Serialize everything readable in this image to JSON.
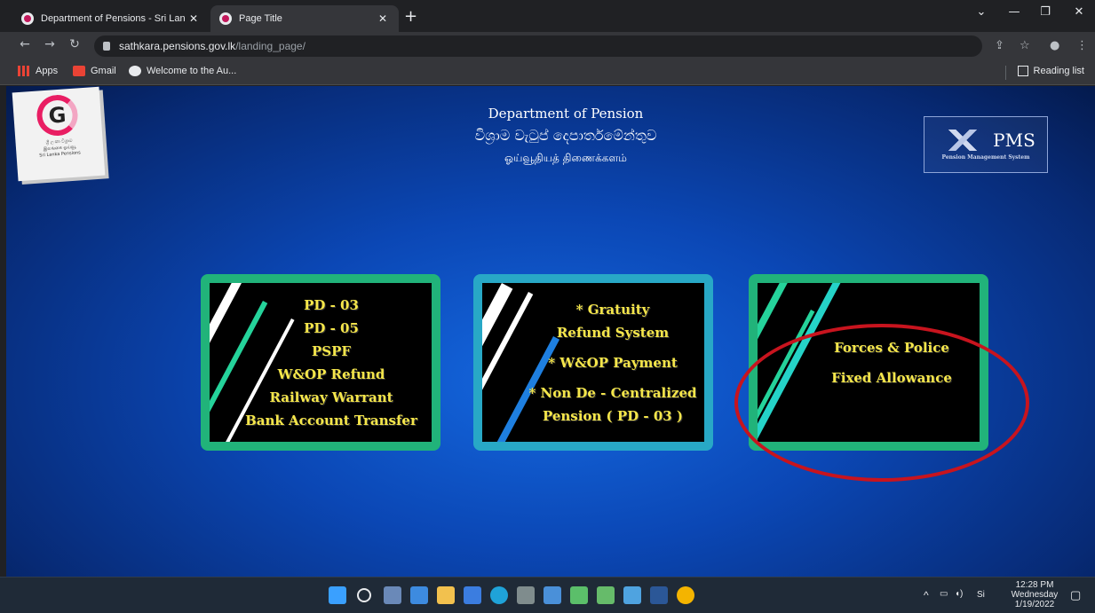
{
  "browser": {
    "tabs": [
      {
        "title": "Department of Pensions - Sri Lan"
      },
      {
        "title": "Page Title"
      }
    ],
    "new_tab": "+",
    "url_host": "sathkara.pensions.gov.lk",
    "url_path": "/landing_page/",
    "bookmarks": [
      {
        "label": "Apps"
      },
      {
        "label": "Gmail"
      },
      {
        "label": "Welcome to the Au..."
      }
    ],
    "reading_list": "Reading list"
  },
  "page": {
    "logo_text": "ශ්‍රී ලංකා විශ්‍රාම\nஇலங்கை ஓய்வூ\nSri Lanka Pensions",
    "title_en": "Department of Pension",
    "title_si": "විශ්‍රාම වැටුප් දෙපාර්තමේන්තුව",
    "title_ta": "ஓய்வூதியத் திணைக்களம்",
    "pms_title": "PMS",
    "pms_subtitle": "Pension Management System",
    "cards": [
      {
        "lines": [
          "PD - 03",
          "PD - 05",
          "PSPF",
          "W&OP Refund",
          "Railway Warrant",
          "Bank Account Transfer"
        ]
      },
      {
        "lines": [
          "* Gratuity",
          "Refund System",
          "* W&OP Payment",
          "* Non De - Centralized",
          "Pension ( PD - 03 )"
        ]
      },
      {
        "lines": [
          "Forces & Police",
          "Fixed Allowance"
        ]
      }
    ]
  },
  "taskbar": {
    "time": "12:28 PM",
    "day": "Wednesday",
    "date": "1/19/2022",
    "lang": "Si"
  }
}
